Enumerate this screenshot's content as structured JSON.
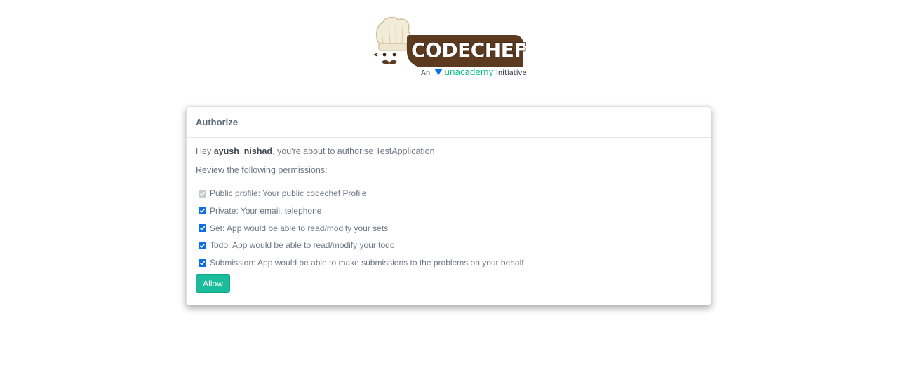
{
  "logo": {
    "brand_text": "CODECHEF",
    "tagline_prefix": "An",
    "tagline_brand": "unacademy",
    "tagline_suffix": "Initiative",
    "brand_color": "#5b3a1f",
    "unacademy_color": "#08bd80"
  },
  "card": {
    "title": "Authorize",
    "intro_prefix": "Hey ",
    "username": "ayush_nishad",
    "intro_suffix": ", you're about to authorise TestApplication",
    "review_text": "Review the following permissions:",
    "permissions": [
      {
        "label": "Public profile: Your public codechef Profile",
        "checked": true,
        "disabled": true
      },
      {
        "label": "Private: Your email, telephone",
        "checked": true,
        "disabled": false
      },
      {
        "label": "Set: App would be able to read/modify your sets",
        "checked": true,
        "disabled": false
      },
      {
        "label": "Todo: App would be able to read/modify your todo",
        "checked": true,
        "disabled": false
      },
      {
        "label": "Submission: App would be able to make submissions to the problems on your behalf",
        "checked": true,
        "disabled": false
      }
    ],
    "allow_label": "Allow",
    "accent_color": "#1bbc9b",
    "checkbox_color": "#0b6fe3"
  }
}
